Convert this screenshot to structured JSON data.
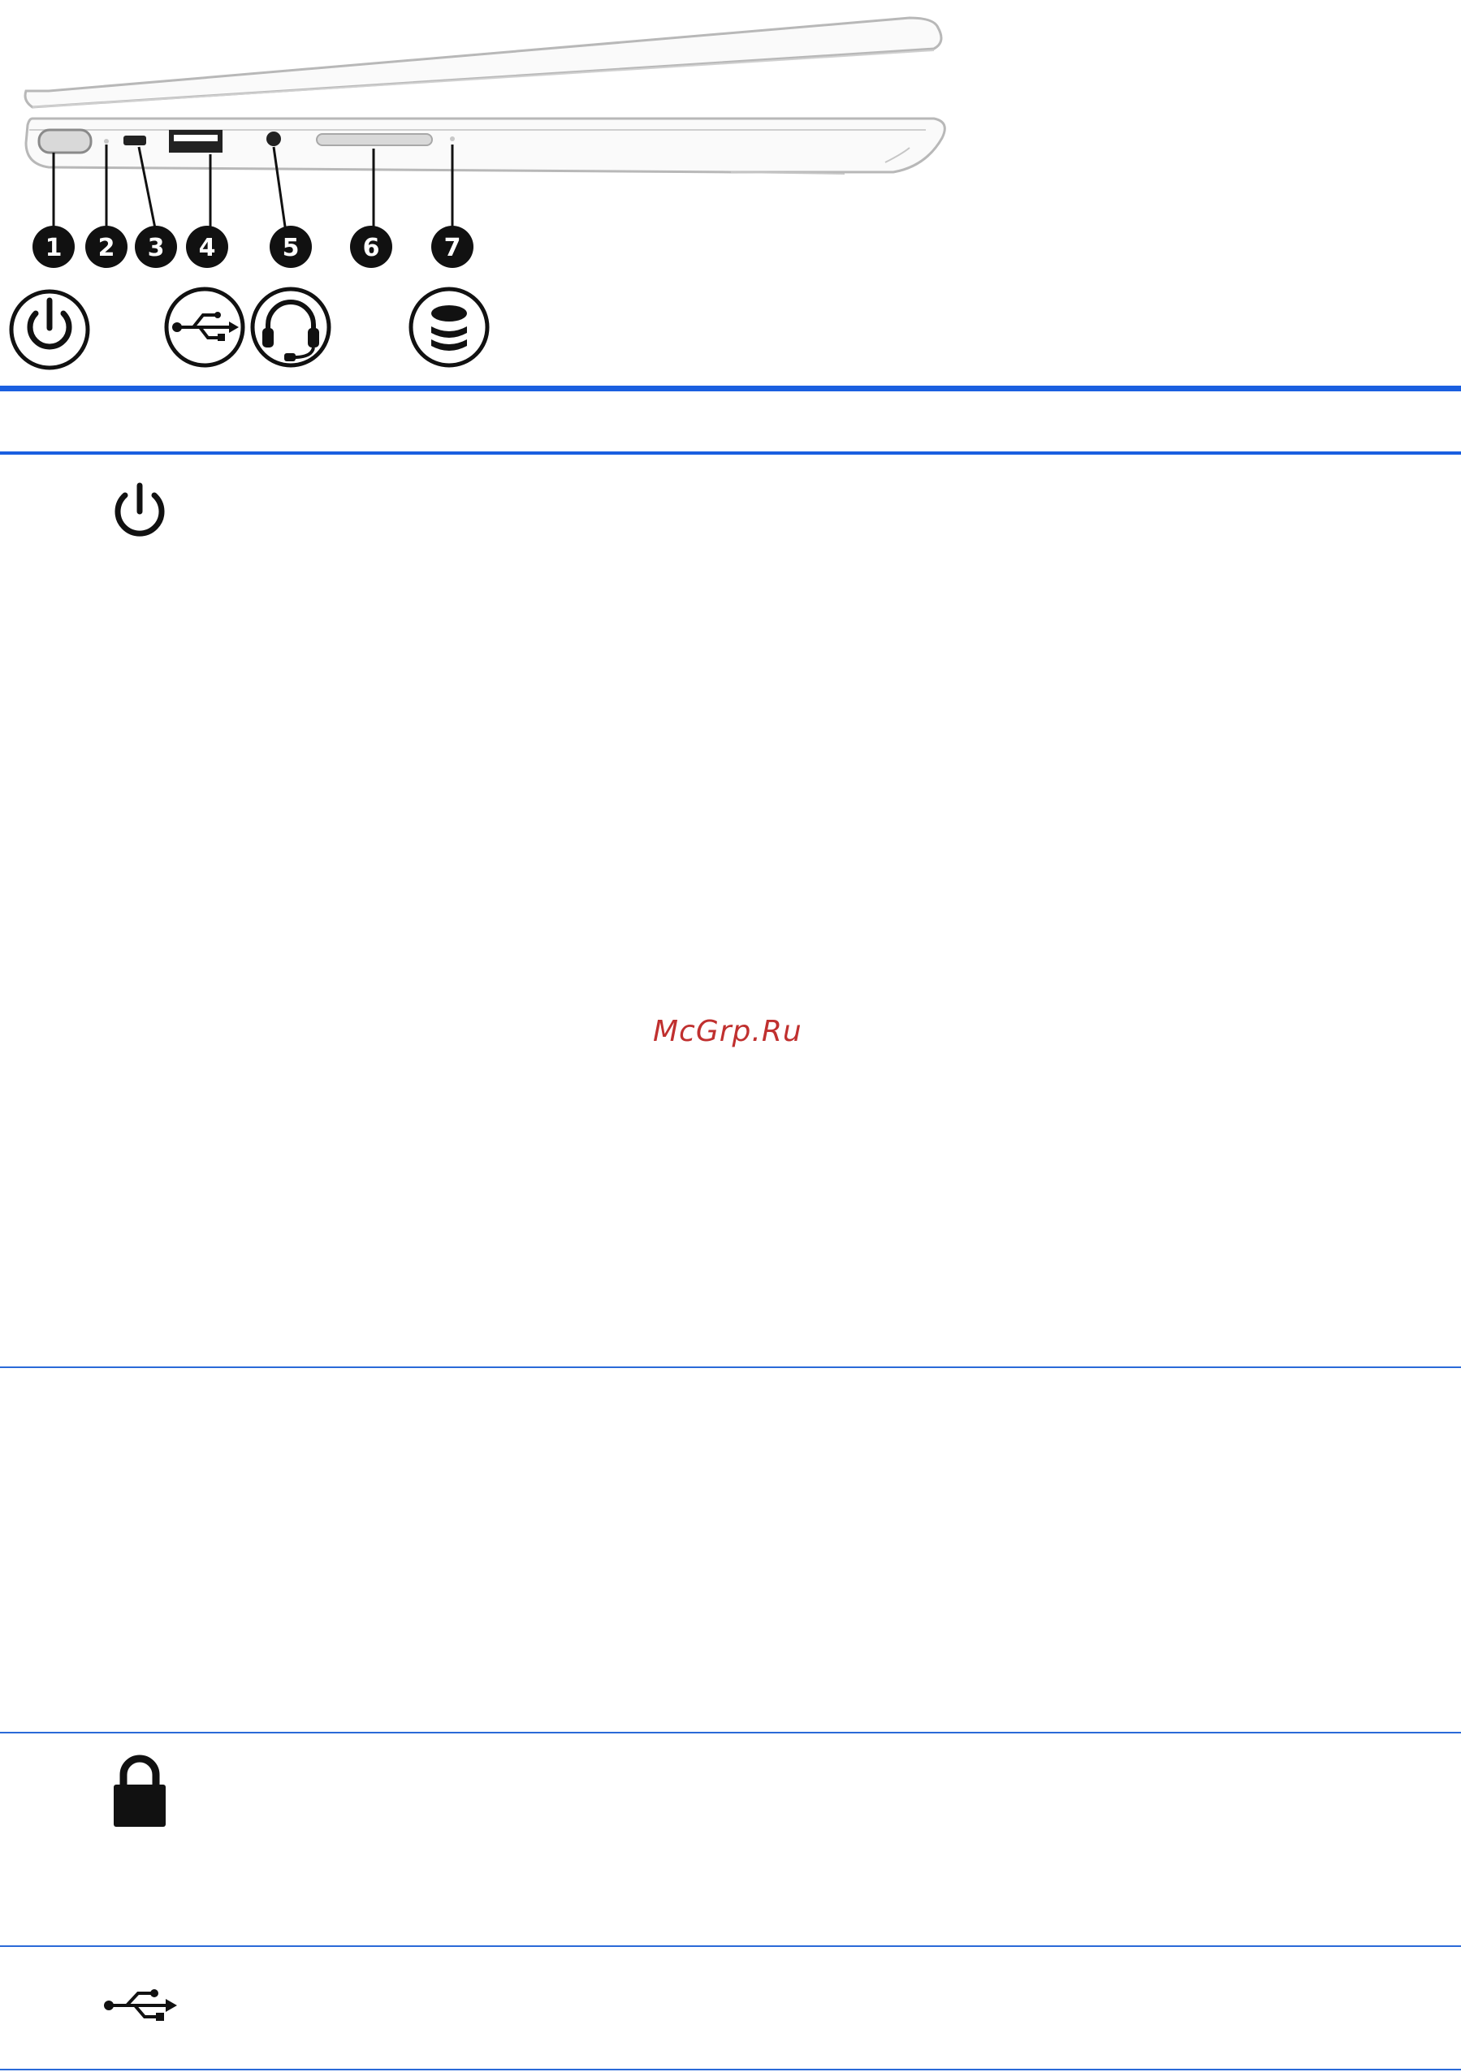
{
  "figure": {
    "callouts": [
      "1",
      "2",
      "3",
      "4",
      "5",
      "6",
      "7"
    ],
    "port_icons": [
      "power-icon",
      "usb-icon",
      "headset-icon",
      "memory-card-icon"
    ]
  },
  "table_rows": [
    {
      "icon": "power-icon"
    },
    {
      "icon": ""
    },
    {
      "icon": "lock-icon"
    },
    {
      "icon": "usb-icon"
    }
  ],
  "watermark": {
    "text": "McGrp.Ru",
    "color": "#c0302f"
  },
  "colors": {
    "rule": "#1a5fe0"
  }
}
